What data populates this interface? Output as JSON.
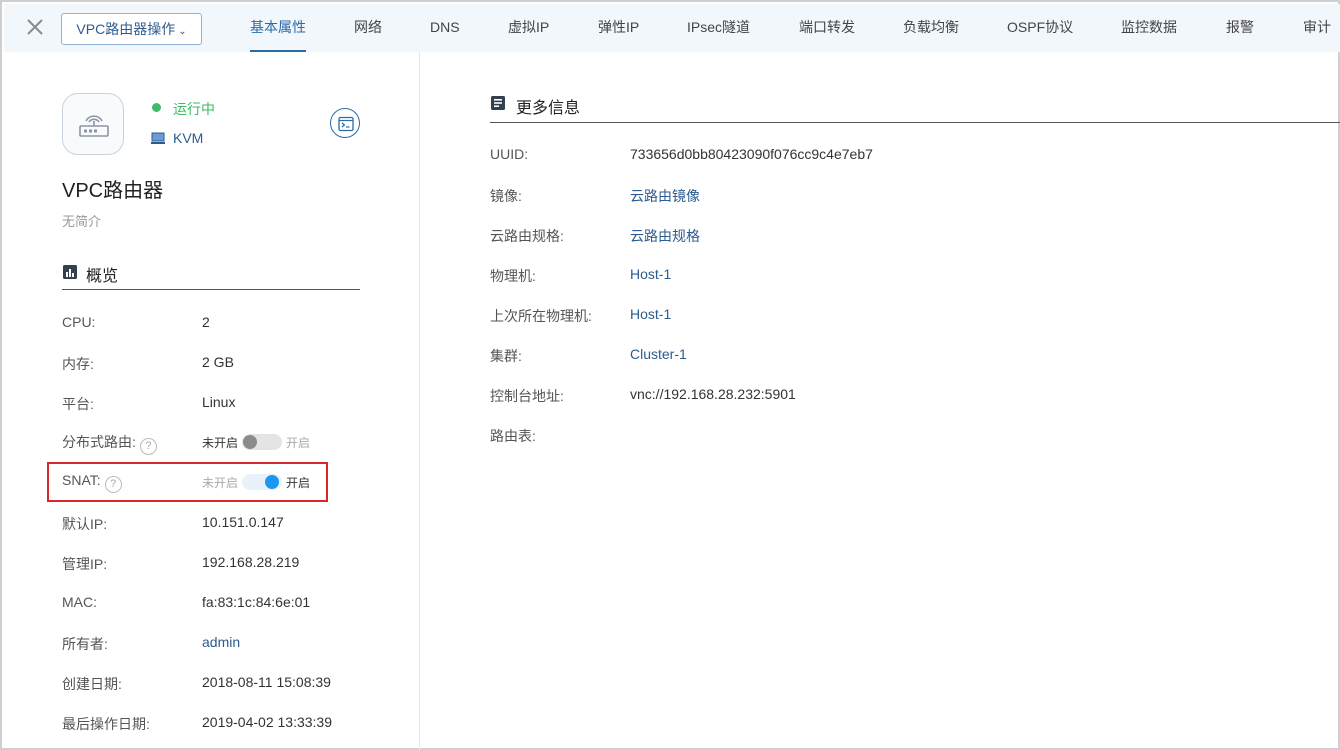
{
  "topbar": {
    "ops_button": "VPC路由器操作",
    "tabs": [
      "基本属性",
      "网络",
      "DNS",
      "虚拟IP",
      "弹性IP",
      "IPsec隧道",
      "端口转发",
      "负载均衡",
      "OSPF协议",
      "监控数据",
      "报警",
      "审计"
    ],
    "active_tab": "基本属性"
  },
  "vm": {
    "status": "运行中",
    "hypervisor": "KVM",
    "name": "VPC路由器",
    "description": "无简介"
  },
  "overview": {
    "title": "概览",
    "cpu": {
      "label": "CPU:",
      "value": "2"
    },
    "memory": {
      "label": "内存:",
      "value": "2 GB"
    },
    "platform": {
      "label": "平台:",
      "value": "Linux"
    },
    "distributed_routing": {
      "label": "分布式路由:",
      "off_label": "未开启",
      "on_label": "开启",
      "state": "off"
    },
    "snat": {
      "label": "SNAT:",
      "off_label": "未开启",
      "on_label": "开启",
      "state": "on"
    },
    "default_ip": {
      "label": "默认IP:",
      "value": "10.151.0.147"
    },
    "mgmt_ip": {
      "label": "管理IP:",
      "value": "192.168.28.219"
    },
    "mac": {
      "label": "MAC:",
      "value": "fa:83:1c:84:6e:01"
    },
    "owner": {
      "label": "所有者:",
      "value": "admin"
    },
    "created": {
      "label": "创建日期:",
      "value": "2018-08-11 15:08:39"
    },
    "last_op": {
      "label": "最后操作日期:",
      "value": "2019-04-02 13:33:39"
    }
  },
  "more_info": {
    "title": "更多信息",
    "uuid": {
      "label": "UUID:",
      "value": "733656d0bb80423090f076cc9c4e7eb7"
    },
    "image": {
      "label": "镜像:",
      "value": "云路由镜像"
    },
    "offering": {
      "label": "云路由规格:",
      "value": "云路由规格"
    },
    "host": {
      "label": "物理机:",
      "value": "Host-1"
    },
    "last_host": {
      "label": "上次所在物理机:",
      "value": "Host-1"
    },
    "cluster": {
      "label": "集群:",
      "value": "Cluster-1"
    },
    "console": {
      "label": "控制台地址:",
      "value": "vnc://192.168.28.232:5901"
    },
    "route_table": {
      "label": "路由表:",
      "value": ""
    }
  },
  "colors": {
    "accent": "#2c6aa8",
    "running": "#3dbb65",
    "toggle_on": "#1d96f0",
    "highlight": "#d9262b"
  },
  "icons": {
    "close": "close-icon",
    "router": "router-icon",
    "monitor": "monitor-icon",
    "console": "console-icon",
    "overview": "chart-icon",
    "info": "document-icon"
  }
}
